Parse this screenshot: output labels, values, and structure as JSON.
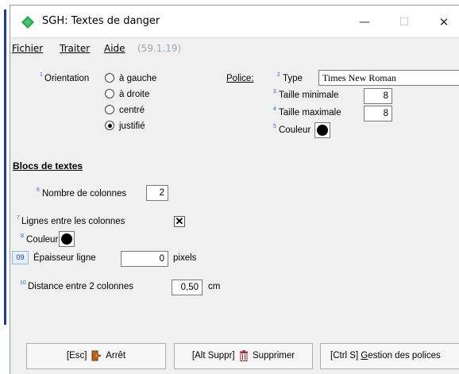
{
  "window": {
    "title": "SGH: Textes de danger",
    "controls": {
      "minimize": "—",
      "maximize": "☐",
      "close": "✕"
    }
  },
  "menu": {
    "fichier": "Fichier",
    "traiter": "Traiter",
    "aide": "Aide",
    "version": "(59.1.19)"
  },
  "orientation": {
    "num": "1",
    "label": "Orientation",
    "options": [
      "à gauche",
      "à droite",
      "centré",
      "justifié"
    ],
    "selected": "justifié"
  },
  "police": {
    "label": "Police:",
    "type": {
      "num": "2",
      "label": "Type",
      "value": "Times New Roman"
    },
    "taille_min": {
      "num": "3",
      "label": "Taille minimale",
      "value": "8"
    },
    "taille_max": {
      "num": "4",
      "label": "Taille maximale",
      "value": "8"
    },
    "couleur": {
      "num": "5",
      "label": "Couleur",
      "color": "#000000"
    }
  },
  "blocs": {
    "title": "Blocs de textes",
    "colonnes": {
      "num": "6",
      "label": "Nombre de colonnes",
      "value": "2"
    },
    "lignes": {
      "num": "7",
      "label": "Lignes entre les colonnes",
      "checked": true,
      "mark": "✕"
    },
    "couleur": {
      "num": "8",
      "label": "Couleur",
      "color": "#000000"
    },
    "epaisseur": {
      "num": "09",
      "label": "Épaisseur ligne",
      "value": "0",
      "unit": "pixels"
    },
    "distance": {
      "num": "10",
      "label": "Distance entre 2 colonnes",
      "value": "0,50",
      "unit": "cm"
    }
  },
  "buttons": {
    "arret": {
      "shortcut": "[Esc]",
      "label": "Arrêt"
    },
    "supprimer": {
      "shortcut": "[Alt Suppr]",
      "label": "Supprimer"
    },
    "polices": {
      "shortcut": "[Ctrl S]",
      "label_pre": "G",
      "label_rest": "estion des polices"
    }
  },
  "colors": {
    "accent": "#1b3f8f",
    "superscript": "#2d6fd6",
    "app_icon": "#1fa845",
    "menu_version": "#9aa6b8"
  }
}
